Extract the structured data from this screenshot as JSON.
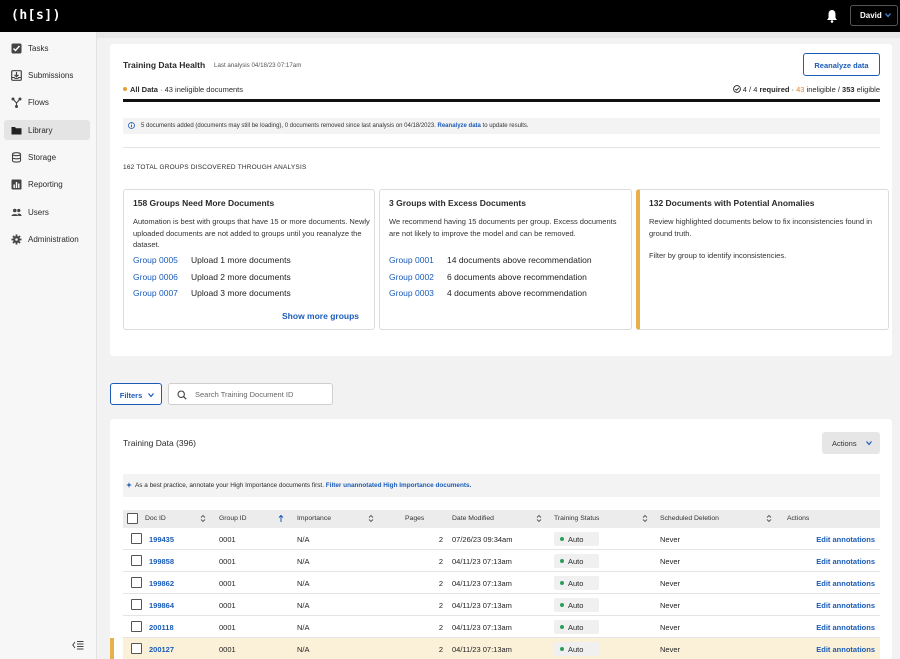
{
  "topbar": {
    "logo": "(h[s])",
    "user_name": "David",
    "icons": [
      "bell-icon",
      "chevron-down-icon"
    ]
  },
  "sidebar": {
    "items": [
      {
        "label": "Tasks",
        "icon": "checkbox-icon"
      },
      {
        "label": "Submissions",
        "icon": "inbox-icon"
      },
      {
        "label": "Flows",
        "icon": "flow-icon"
      },
      {
        "label": "Library",
        "icon": "folder-icon",
        "active": true
      },
      {
        "label": "Storage",
        "icon": "database-icon"
      },
      {
        "label": "Reporting",
        "icon": "chart-icon"
      },
      {
        "label": "Users",
        "icon": "users-icon"
      },
      {
        "label": "Administration",
        "icon": "gear-icon"
      }
    ]
  },
  "health": {
    "title": "Training Data Health",
    "last_analysis": "Last analysis 04/18/23 07:17am",
    "reanalyze_label": "Reanalyze data",
    "all_data_label": "All Data",
    "ineligible_summary": "· 43 ineligible documents",
    "required_count": "4 / 4",
    "required_label": "required",
    "ineligible_count": "43",
    "ineligible_label": "ineligible /",
    "eligible_count": "353",
    "eligible_label": "eligible",
    "info_text": "5 documents added (documents may still be loading), 0 documents removed since last analysis on 04/18/2023.",
    "info_link": "Reanalyze data",
    "info_suffix": "to update results.",
    "groups_count": "162 TOTAL GROUPS DISCOVERED THROUGH ANALYSIS",
    "cards": [
      {
        "title": "158 Groups Need More Documents",
        "description": "Automation is best with groups that have 15 or more documents. Newly uploaded documents are not added to groups until you reanalyze the dataset.",
        "rows": [
          {
            "group": "Group 0005",
            "value": "Upload 1 more documents"
          },
          {
            "group": "Group 0006",
            "value": "Upload 2 more documents"
          },
          {
            "group": "Group 0007",
            "value": "Upload 3 more documents"
          }
        ],
        "more_label": "Show more groups"
      },
      {
        "title": "3 Groups with Excess Documents",
        "description": "We recommend having 15 documents per group. Excess documents are not likely to improve the model and can be removed.",
        "rows": [
          {
            "group": "Group 0001",
            "value": "14 documents above recommendation"
          },
          {
            "group": "Group 0002",
            "value": "6 documents above recommendation"
          },
          {
            "group": "Group 0003",
            "value": "4 documents above recommendation"
          }
        ]
      },
      {
        "title": "132 Documents with Potential Anomalies",
        "description": "Review highlighted documents below to fix inconsistencies found in ground truth.",
        "description2": "Filter by group to identify inconsistencies."
      }
    ]
  },
  "filters": {
    "filters_label": "Filters",
    "search_placeholder": "Search Training Document ID"
  },
  "training": {
    "title": "Training Data (396)",
    "actions_label": "Actions",
    "tip_text": "As a best practice, annotate your High Importance documents first.",
    "tip_link": "Filter unannotated High Importance documents.",
    "columns": [
      "Doc ID",
      "Group ID",
      "Importance",
      "Pages",
      "Date Modified",
      "Training Status",
      "Scheduled Deletion",
      "Actions"
    ],
    "rows": [
      {
        "doc_id": "199435",
        "group_id": "0001",
        "importance": "N/A",
        "pages": "2",
        "date": "07/26/23 09:34am",
        "status": "Auto",
        "deletion": "Never",
        "action": "Edit annotations"
      },
      {
        "doc_id": "199858",
        "group_id": "0001",
        "importance": "N/A",
        "pages": "2",
        "date": "04/11/23 07:13am",
        "status": "Auto",
        "deletion": "Never",
        "action": "Edit annotations"
      },
      {
        "doc_id": "199862",
        "group_id": "0001",
        "importance": "N/A",
        "pages": "2",
        "date": "04/11/23 07:13am",
        "status": "Auto",
        "deletion": "Never",
        "action": "Edit annotations"
      },
      {
        "doc_id": "199864",
        "group_id": "0001",
        "importance": "N/A",
        "pages": "2",
        "date": "04/11/23 07:13am",
        "status": "Auto",
        "deletion": "Never",
        "action": "Edit annotations"
      },
      {
        "doc_id": "200118",
        "group_id": "0001",
        "importance": "N/A",
        "pages": "2",
        "date": "04/11/23 07:13am",
        "status": "Auto",
        "deletion": "Never",
        "action": "Edit annotations"
      },
      {
        "doc_id": "200127",
        "group_id": "0001",
        "importance": "N/A",
        "pages": "2",
        "date": "04/11/23 07:13am",
        "status": "Auto",
        "deletion": "Never",
        "action": "Edit annotations",
        "highlighted": true
      }
    ]
  },
  "colors": {
    "accent": "#1a5cb8",
    "warning": "#e8b04a",
    "status_green": "#2e9e5b",
    "topbar": "#000000"
  }
}
